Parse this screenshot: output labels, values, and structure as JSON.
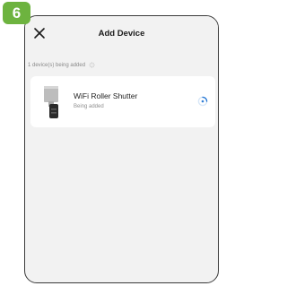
{
  "step_badge": {
    "number": "6",
    "color": "#6db33f"
  },
  "header": {
    "title": "Add Device",
    "close_icon": "close-icon"
  },
  "status": {
    "text": "1 device(s) being added",
    "icon": "spinner-icon"
  },
  "device": {
    "name": "WiFi Roller Shutter",
    "status": "Being added",
    "icon": "roller-shutter-device-icon",
    "loading_icon": "loading-spinner-icon"
  },
  "colors": {
    "accent": "#2f7dd6",
    "background": "#f2f2f2",
    "card": "#ffffff"
  }
}
